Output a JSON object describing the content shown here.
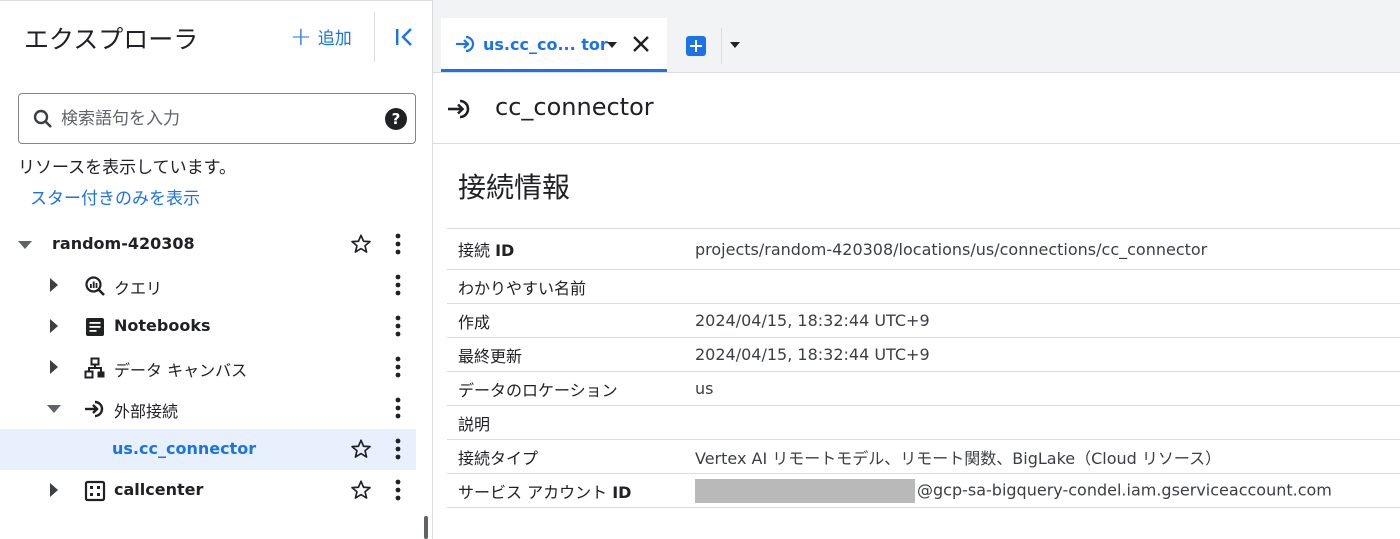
{
  "explorer": {
    "title": "エクスプローラ",
    "add_label": "追加",
    "search": {
      "placeholder": "検索語句を入力"
    },
    "showing_resources_text": "リソースを表示しています。",
    "starred_only_link": "スター付きのみを表示",
    "tree": {
      "project": {
        "label": "random-420308",
        "expanded": true
      },
      "queries": {
        "label": "クエリ"
      },
      "notebooks": {
        "label": "Notebooks"
      },
      "data_canvas": {
        "label": "データ キャンバス"
      },
      "external_connections": {
        "label": "外部接続",
        "expanded": true
      },
      "connector": {
        "label": "us.cc_connector",
        "selected": true
      },
      "dataset": {
        "label": "callcenter"
      }
    }
  },
  "tabs": {
    "active_label": "us.cc_co... tor"
  },
  "resource": {
    "title": "cc_connector",
    "section_title": "接続情報",
    "rows": [
      {
        "key_pre": "接続 ",
        "key_bold": "ID",
        "value": "projects/random-420308/locations/us/connections/cc_connector"
      },
      {
        "key_pre": "わかりやすい名前",
        "key_bold": "",
        "value": ""
      },
      {
        "key_pre": "作成",
        "key_bold": "",
        "value": "2024/04/15, 18:32:44 UTC+9"
      },
      {
        "key_pre": "最終更新",
        "key_bold": "",
        "value": "2024/04/15, 18:32:44 UTC+9"
      },
      {
        "key_pre": "データのロケーション",
        "key_bold": "",
        "value": "us"
      },
      {
        "key_pre": "説明",
        "key_bold": "",
        "value": ""
      },
      {
        "key_pre": "接続タイプ",
        "key_bold": "",
        "value": "Vertex AI リモートモデル、リモート関数、BigLake（Cloud リソース）"
      },
      {
        "key_pre": "サービス アカウント ",
        "key_bold": "ID",
        "value": "@gcp-sa-bigquery-condel.iam.gserviceaccount.com"
      }
    ]
  },
  "colors": {
    "accent": "#1a73e8",
    "selected_bg": "#e8f0fe",
    "divider": "#dadce0"
  }
}
